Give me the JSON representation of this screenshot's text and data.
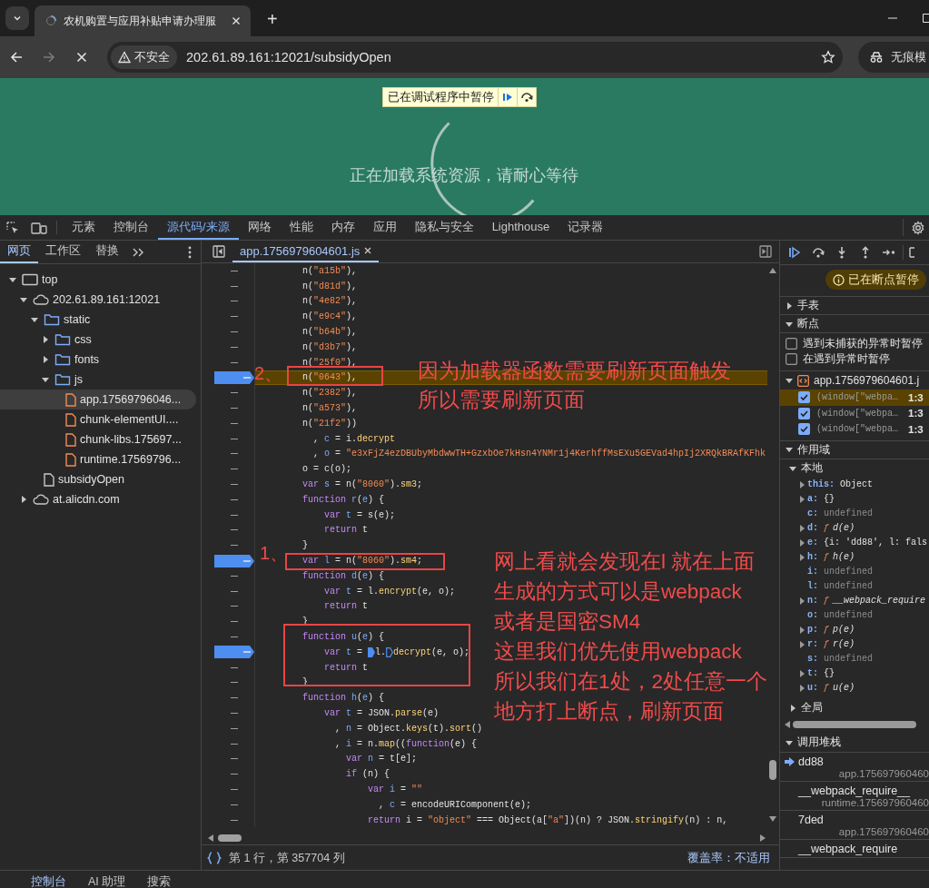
{
  "browser": {
    "tabs": [
      {
        "title": "农机购置与应用补贴申请办理服",
        "selected": true,
        "loading": true
      }
    ],
    "new_tab": "+",
    "security_label": "不安全",
    "url": "202.61.89.161:12021/subsidyOpen",
    "profile_label": "无痕模"
  },
  "page": {
    "debugger_banner": "已在调试程序中暂停",
    "loading_text": "正在加载系统资源，请耐心等待"
  },
  "devtools": {
    "tabs": [
      {
        "label": "元素",
        "selected": false
      },
      {
        "label": "控制台",
        "selected": false
      },
      {
        "label": "源代码/来源",
        "selected": true
      },
      {
        "label": "网络",
        "selected": false
      },
      {
        "label": "性能",
        "selected": false
      },
      {
        "label": "内存",
        "selected": false
      },
      {
        "label": "应用",
        "selected": false
      },
      {
        "label": "隐私与安全",
        "selected": false
      },
      {
        "label": "Lighthouse",
        "selected": false
      },
      {
        "label": "记录器",
        "selected": false
      }
    ],
    "navigator": {
      "tabs": [
        {
          "label": "网页",
          "selected": true
        },
        {
          "label": "工作区",
          "selected": false
        },
        {
          "label": "替换",
          "selected": false
        }
      ],
      "tree": [
        {
          "label": "top",
          "kind": "frame",
          "expanded": true,
          "selected": false,
          "children": [
            {
              "label": "202.61.89.161:12021",
              "kind": "domain",
              "expanded": true,
              "selected": false,
              "children": [
                {
                  "label": "static",
                  "kind": "folder",
                  "expanded": true,
                  "selected": false,
                  "children": [
                    {
                      "label": "css",
                      "kind": "folder",
                      "expanded": false,
                      "selected": false
                    },
                    {
                      "label": "fonts",
                      "kind": "folder",
                      "expanded": false,
                      "selected": false
                    },
                    {
                      "label": "js",
                      "kind": "folder",
                      "expanded": true,
                      "selected": false,
                      "children": [
                        {
                          "label": "app.17569796046...",
                          "kind": "script",
                          "selected": true
                        },
                        {
                          "label": "chunk-elementUI....",
                          "kind": "script",
                          "selected": false
                        },
                        {
                          "label": "chunk-libs.175697...",
                          "kind": "script",
                          "selected": false
                        },
                        {
                          "label": "runtime.17569796...",
                          "kind": "script",
                          "selected": false
                        }
                      ]
                    }
                  ]
                },
                {
                  "label": "subsidyOpen",
                  "kind": "document",
                  "selected": false
                }
              ]
            },
            {
              "label": "at.alicdn.com",
              "kind": "domain",
              "expanded": false,
              "selected": false
            }
          ]
        }
      ]
    },
    "editor": {
      "tab": {
        "label": "app.1756979604601.js"
      },
      "lines": [
        {
          "breakpoint": false,
          "paused": false,
          "tokens": [
            {
              "kind": "plain",
              "text": "        n("
            },
            {
              "kind": "string",
              "text": "\"a15b\""
            },
            {
              "kind": "plain",
              "text": "),"
            }
          ]
        },
        {
          "breakpoint": false,
          "paused": false,
          "tokens": [
            {
              "kind": "plain",
              "text": "        n("
            },
            {
              "kind": "string",
              "text": "\"d81d\""
            },
            {
              "kind": "plain",
              "text": "),"
            }
          ]
        },
        {
          "breakpoint": false,
          "paused": false,
          "tokens": [
            {
              "kind": "plain",
              "text": "        n("
            },
            {
              "kind": "string",
              "text": "\"4e82\""
            },
            {
              "kind": "plain",
              "text": "),"
            }
          ]
        },
        {
          "breakpoint": false,
          "paused": false,
          "tokens": [
            {
              "kind": "plain",
              "text": "        n("
            },
            {
              "kind": "string",
              "text": "\"e9c4\""
            },
            {
              "kind": "plain",
              "text": "),"
            }
          ]
        },
        {
          "breakpoint": false,
          "paused": false,
          "tokens": [
            {
              "kind": "plain",
              "text": "        n("
            },
            {
              "kind": "string",
              "text": "\"b64b\""
            },
            {
              "kind": "plain",
              "text": "),"
            }
          ]
        },
        {
          "breakpoint": false,
          "paused": false,
          "tokens": [
            {
              "kind": "plain",
              "text": "        n("
            },
            {
              "kind": "string",
              "text": "\"d3b7\""
            },
            {
              "kind": "plain",
              "text": "),"
            }
          ]
        },
        {
          "breakpoint": false,
          "paused": false,
          "tokens": [
            {
              "kind": "plain",
              "text": "        n("
            },
            {
              "kind": "string",
              "text": "\"25f0\""
            },
            {
              "kind": "plain",
              "text": "),"
            }
          ]
        },
        {
          "breakpoint": true,
          "paused": true,
          "tokens": [
            {
              "kind": "plain",
              "text": "        n("
            },
            {
              "kind": "string",
              "text": "\"0643\""
            },
            {
              "kind": "plain",
              "text": "),"
            }
          ]
        },
        {
          "breakpoint": false,
          "paused": false,
          "tokens": [
            {
              "kind": "plain",
              "text": "        n("
            },
            {
              "kind": "string",
              "text": "\"2382\""
            },
            {
              "kind": "plain",
              "text": "),"
            }
          ]
        },
        {
          "breakpoint": false,
          "paused": false,
          "tokens": [
            {
              "kind": "plain",
              "text": "        n("
            },
            {
              "kind": "string",
              "text": "\"a573\""
            },
            {
              "kind": "plain",
              "text": "),"
            }
          ]
        },
        {
          "breakpoint": false,
          "paused": false,
          "tokens": [
            {
              "kind": "plain",
              "text": "        n("
            },
            {
              "kind": "string",
              "text": "\"21f2\""
            },
            {
              "kind": "plain",
              "text": "))"
            }
          ]
        },
        {
          "breakpoint": false,
          "paused": false,
          "tokens": [
            {
              "kind": "plain",
              "text": "          , "
            },
            {
              "kind": "name",
              "text": "c"
            },
            {
              "kind": "plain",
              "text": " = i."
            },
            {
              "kind": "method",
              "text": "decrypt"
            }
          ]
        },
        {
          "breakpoint": false,
          "paused": false,
          "tokens": [
            {
              "kind": "plain",
              "text": "          , "
            },
            {
              "kind": "name",
              "text": "o"
            },
            {
              "kind": "plain",
              "text": " = "
            },
            {
              "kind": "string",
              "text": "\"e3xFjZ4ezDBUbyMbdwwTH+GzxbOe7kHsn4YNMr1j4KerhffMsEXu5GEVad4hpIj2XRQkBRAfKFhk"
            }
          ]
        },
        {
          "breakpoint": false,
          "paused": false,
          "tokens": [
            {
              "kind": "plain",
              "text": "        o = c(o);"
            }
          ]
        },
        {
          "breakpoint": false,
          "paused": false,
          "tokens": [
            {
              "kind": "keyword",
              "text": "        var"
            },
            {
              "kind": "name",
              "text": " s"
            },
            {
              "kind": "plain",
              "text": " = n("
            },
            {
              "kind": "string",
              "text": "\"8060\""
            },
            {
              "kind": "plain",
              "text": ")."
            },
            {
              "kind": "method",
              "text": "sm3"
            },
            {
              "kind": "plain",
              "text": ";"
            }
          ]
        },
        {
          "breakpoint": false,
          "paused": false,
          "tokens": [
            {
              "kind": "keyword",
              "text": "        function"
            },
            {
              "kind": "name",
              "text": " r"
            },
            {
              "kind": "plain",
              "text": "("
            },
            {
              "kind": "name",
              "text": "e"
            },
            {
              "kind": "plain",
              "text": ") {"
            }
          ]
        },
        {
          "breakpoint": false,
          "paused": false,
          "tokens": [
            {
              "kind": "keyword",
              "text": "            var"
            },
            {
              "kind": "name",
              "text": " t"
            },
            {
              "kind": "plain",
              "text": " = s(e);"
            }
          ]
        },
        {
          "breakpoint": false,
          "paused": false,
          "tokens": [
            {
              "kind": "keyword",
              "text": "            return"
            },
            {
              "kind": "plain",
              "text": " t"
            }
          ]
        },
        {
          "breakpoint": false,
          "paused": false,
          "tokens": [
            {
              "kind": "plain",
              "text": "        }"
            }
          ]
        },
        {
          "breakpoint": true,
          "paused": false,
          "tokens": [
            {
              "kind": "keyword",
              "text": "        var"
            },
            {
              "kind": "name",
              "text": " l"
            },
            {
              "kind": "plain",
              "text": " = n("
            },
            {
              "kind": "string",
              "text": "\"8060\""
            },
            {
              "kind": "plain",
              "text": ")."
            },
            {
              "kind": "method",
              "text": "sm4"
            },
            {
              "kind": "plain",
              "text": ";"
            }
          ]
        },
        {
          "breakpoint": false,
          "paused": false,
          "tokens": [
            {
              "kind": "keyword",
              "text": "        function"
            },
            {
              "kind": "name",
              "text": " d"
            },
            {
              "kind": "plain",
              "text": "("
            },
            {
              "kind": "name",
              "text": "e"
            },
            {
              "kind": "plain",
              "text": ") {"
            }
          ]
        },
        {
          "breakpoint": false,
          "paused": false,
          "tokens": [
            {
              "kind": "keyword",
              "text": "            var"
            },
            {
              "kind": "name",
              "text": " t"
            },
            {
              "kind": "plain",
              "text": " = l."
            },
            {
              "kind": "method",
              "text": "encrypt"
            },
            {
              "kind": "plain",
              "text": "(e, o);"
            }
          ]
        },
        {
          "breakpoint": false,
          "paused": false,
          "tokens": [
            {
              "kind": "keyword",
              "text": "            return"
            },
            {
              "kind": "plain",
              "text": " t"
            }
          ]
        },
        {
          "breakpoint": false,
          "paused": false,
          "tokens": [
            {
              "kind": "plain",
              "text": "        }"
            }
          ]
        },
        {
          "breakpoint": false,
          "paused": false,
          "tokens": [
            {
              "kind": "keyword",
              "text": "        function"
            },
            {
              "kind": "name",
              "text": " u"
            },
            {
              "kind": "plain",
              "text": "("
            },
            {
              "kind": "name",
              "text": "e"
            },
            {
              "kind": "plain",
              "text": ") {"
            }
          ]
        },
        {
          "breakpoint": true,
          "paused": false,
          "tokens": [
            {
              "kind": "keyword",
              "text": "            var"
            },
            {
              "kind": "name",
              "text": " t"
            },
            {
              "kind": "plain",
              "text": " = "
            },
            {
              "kind": "marker",
              "active": true
            },
            {
              "kind": "plain",
              "text": "l."
            },
            {
              "kind": "marker",
              "active": false
            },
            {
              "kind": "method",
              "text": "decrypt"
            },
            {
              "kind": "plain",
              "text": "(e, o);"
            }
          ]
        },
        {
          "breakpoint": false,
          "paused": false,
          "tokens": [
            {
              "kind": "keyword",
              "text": "            return"
            },
            {
              "kind": "plain",
              "text": " t"
            }
          ]
        },
        {
          "breakpoint": false,
          "paused": false,
          "tokens": [
            {
              "kind": "plain",
              "text": "        }"
            }
          ]
        },
        {
          "breakpoint": false,
          "paused": false,
          "tokens": [
            {
              "kind": "keyword",
              "text": "        function"
            },
            {
              "kind": "name",
              "text": " h"
            },
            {
              "kind": "plain",
              "text": "("
            },
            {
              "kind": "name",
              "text": "e"
            },
            {
              "kind": "plain",
              "text": ") {"
            }
          ]
        },
        {
          "breakpoint": false,
          "paused": false,
          "tokens": [
            {
              "kind": "keyword",
              "text": "            var"
            },
            {
              "kind": "name",
              "text": " t"
            },
            {
              "kind": "plain",
              "text": " = JSON."
            },
            {
              "kind": "method",
              "text": "parse"
            },
            {
              "kind": "plain",
              "text": "(e)"
            }
          ]
        },
        {
          "breakpoint": false,
          "paused": false,
          "tokens": [
            {
              "kind": "plain",
              "text": "              , "
            },
            {
              "kind": "name",
              "text": "n"
            },
            {
              "kind": "plain",
              "text": " = Object."
            },
            {
              "kind": "method",
              "text": "keys"
            },
            {
              "kind": "plain",
              "text": "(t)."
            },
            {
              "kind": "method",
              "text": "sort"
            },
            {
              "kind": "plain",
              "text": "()"
            }
          ]
        },
        {
          "breakpoint": false,
          "paused": false,
          "tokens": [
            {
              "kind": "plain",
              "text": "              , "
            },
            {
              "kind": "name",
              "text": "i"
            },
            {
              "kind": "plain",
              "text": " = n."
            },
            {
              "kind": "method",
              "text": "map"
            },
            {
              "kind": "plain",
              "text": "(("
            },
            {
              "kind": "keyword",
              "text": "function"
            },
            {
              "kind": "plain",
              "text": "(e) {"
            }
          ]
        },
        {
          "breakpoint": false,
          "paused": false,
          "tokens": [
            {
              "kind": "keyword",
              "text": "                var"
            },
            {
              "kind": "name",
              "text": " n"
            },
            {
              "kind": "plain",
              "text": " = t[e];"
            }
          ]
        },
        {
          "breakpoint": false,
          "paused": false,
          "tokens": [
            {
              "kind": "keyword",
              "text": "                if"
            },
            {
              "kind": "plain",
              "text": " (n) {"
            }
          ]
        },
        {
          "breakpoint": false,
          "paused": false,
          "tokens": [
            {
              "kind": "keyword",
              "text": "                    var"
            },
            {
              "kind": "name",
              "text": " i"
            },
            {
              "kind": "plain",
              "text": " = "
            },
            {
              "kind": "string",
              "text": "\"\""
            }
          ]
        },
        {
          "breakpoint": false,
          "paused": false,
          "tokens": [
            {
              "kind": "plain",
              "text": "                      , "
            },
            {
              "kind": "name",
              "text": "c"
            },
            {
              "kind": "plain",
              "text": " = encodeURIComponent(e);"
            }
          ]
        },
        {
          "breakpoint": false,
          "paused": false,
          "tokens": [
            {
              "kind": "keyword",
              "text": "                    return"
            },
            {
              "kind": "plain",
              "text": " i = "
            },
            {
              "kind": "string",
              "text": "\"object\""
            },
            {
              "kind": "plain",
              "text": " === Object(a["
            },
            {
              "kind": "string",
              "text": "\"a\""
            },
            {
              "kind": "plain",
              "text": "])(n) ? JSON."
            },
            {
              "kind": "method",
              "text": "stringify"
            },
            {
              "kind": "plain",
              "text": "(n) : n,"
            }
          ]
        }
      ],
      "annotations": [
        {
          "kind": "label",
          "text": "2、"
        },
        {
          "kind": "box"
        },
        {
          "kind": "note",
          "lines": [
            "因为加载器函数需要刷新页面触发",
            "所以需要刷新页面"
          ]
        },
        {
          "kind": "label",
          "text": "1、"
        },
        {
          "kind": "box"
        },
        {
          "kind": "box"
        },
        {
          "kind": "note",
          "lines": [
            "网上看就会发现在l 就在上面",
            "生成的方式可以是webpack",
            "或者是国密SM4",
            "这里我们优先使用webpack",
            "所以我们在1处，2处任意一个",
            "地方打上断点，刷新页面"
          ]
        }
      ],
      "status": {
        "position": "第 1 行，第 357704 列",
        "coverage": "覆盖率：不适用"
      }
    },
    "debugger": {
      "status": "已在断点暂停",
      "watch": {
        "label": "手表",
        "expanded": false
      },
      "breakpoints": {
        "label": "断点",
        "expanded": true,
        "options": [
          {
            "label": "遇到未捕获的异常时暂停",
            "checked": false
          },
          {
            "label": "在遇到异常时暂停",
            "checked": false
          }
        ],
        "file": {
          "label": "app.1756979604601.j",
          "expanded": true
        },
        "items": [
          {
            "code": "(window[\"webpa…",
            "location": "1:3",
            "checked": true,
            "selected": true
          },
          {
            "code": "(window[\"webpa…",
            "location": "1:3",
            "checked": true,
            "selected": false
          },
          {
            "code": "(window[\"webpa…",
            "location": "1:3",
            "checked": true,
            "selected": false
          }
        ]
      },
      "scope": {
        "label": "作用域",
        "expanded": true,
        "local": {
          "label": "本地",
          "expanded": true,
          "vars": [
            {
              "name": "this:",
              "value": "Object",
              "kind": "object",
              "expandable": true
            },
            {
              "name": "a:",
              "value": "{}",
              "kind": "object",
              "expandable": true
            },
            {
              "name": "c:",
              "value": "undefined",
              "kind": "undefined",
              "expandable": false
            },
            {
              "name": "d:",
              "prefix": "ƒ",
              "value": "d(e)",
              "kind": "function",
              "expandable": true
            },
            {
              "name": "e:",
              "value": "{i: 'dd88', l: fals",
              "kind": "object",
              "expandable": true
            },
            {
              "name": "h:",
              "prefix": "ƒ",
              "value": "h(e)",
              "kind": "function",
              "expandable": true
            },
            {
              "name": "i:",
              "value": "undefined",
              "kind": "undefined",
              "expandable": false
            },
            {
              "name": "l:",
              "value": "undefined",
              "kind": "undefined",
              "expandable": false
            },
            {
              "name": "n:",
              "prefix": "ƒ",
              "value": "__webpack_require",
              "kind": "function",
              "expandable": true
            },
            {
              "name": "o:",
              "value": "undefined",
              "kind": "undefined",
              "expandable": false
            },
            {
              "name": "p:",
              "prefix": "ƒ",
              "value": "p(e)",
              "kind": "function",
              "expandable": true
            },
            {
              "name": "r:",
              "prefix": "ƒ",
              "value": "r(e)",
              "kind": "function",
              "expandable": true
            },
            {
              "name": "s:",
              "value": "undefined",
              "kind": "undefined",
              "expandable": false
            },
            {
              "name": "t:",
              "value": "{}",
              "kind": "object",
              "expandable": true
            },
            {
              "name": "u:",
              "prefix": "ƒ",
              "value": "u(e)",
              "kind": "function",
              "expandable": true
            }
          ]
        },
        "global": {
          "label": "全局",
          "expanded": false
        }
      },
      "call_stack": {
        "label": "调用堆栈",
        "expanded": true,
        "frames": [
          {
            "name": "dd88",
            "file": "app.175697960460",
            "selected": true
          },
          {
            "name": "__webpack_require__",
            "file": "runtime.175697960460",
            "selected": false
          },
          {
            "name": "7ded",
            "file": "app.175697960460",
            "selected": false
          },
          {
            "name": "__webpack_require",
            "selected": false
          }
        ]
      }
    },
    "drawer": {
      "tabs": [
        {
          "label": "控制台",
          "selected": true
        },
        {
          "label": "AI 助理",
          "selected": false
        },
        {
          "label": "搜索",
          "selected": false
        }
      ]
    }
  }
}
